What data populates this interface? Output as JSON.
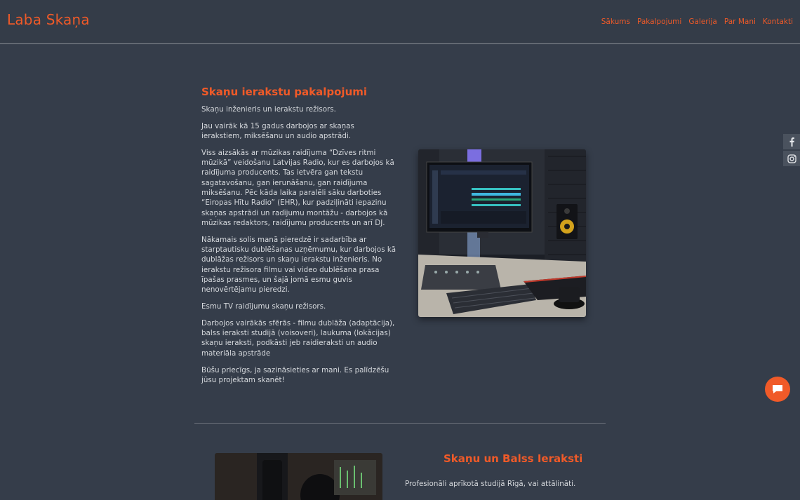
{
  "header": {
    "logo": "Laba Skaņa",
    "nav": [
      "Sākums",
      "Pakalpojumi",
      "Galerija",
      "Par Mani",
      "Kontakti"
    ]
  },
  "about": {
    "title": "Skaņu ierakstu pakalpojumi",
    "paragraphs": [
      "Skaņu inženieris un ierakstu režisors.",
      "Jau vairāk kā 15 gadus darbojos ar skaņas ierakstiem, miksēšanu un audio apstrādi.",
      "Viss aizsākās ar mūzikas raidījuma “Dzīves ritmi mūzikā” veidošanu Latvijas Radio, kur es darbojos kā raidījuma producents. Tas ietvēra gan tekstu sagatavošanu, gan ierunāšanu, gan raidījuma miksēšanu. Pēc kāda laika paralēli sāku darboties “Eiropas Hītu Radio” (EHR), kur padziļināti iepazinu skaņas apstrādi un radījumu montāžu - darbojos kā mūzikas redaktors, raidījumu producents un arī DJ.",
      "Nākamais solis manā pieredzē ir sadarbība ar starptautisku dublēšanas uzņēmumu, kur darbojos kā dublāžas režisors un skaņu ierakstu inženieris. No ierakstu režisora filmu vai video dublēšana prasa īpašas prasmes, un šajā jomā esmu guvis nenovērtējamu pieredzi.",
      "Esmu TV raidījumu skaņu režisors.",
      "Darbojos vairākās sfērās - filmu dublāža (adaptācija), balss ieraksti studijā (voisoveri), laukuma (lokācijas) skaņu ieraksti, podkāsti jeb raidieraksti un audio materiāla apstrāde",
      "Būšu priecīgs, ja sazināsieties ar mani. Es palīdzēšu jūsu projektam skanēt!"
    ]
  },
  "section2": {
    "title": "Skaņu un Balss Ieraksti",
    "text": "Profesionāli aprīkotā studijā Rīgā, vai attālināti."
  },
  "colors": {
    "accent": "#f05a28",
    "background": "#353d4a"
  },
  "icons": {
    "social": [
      "facebook-icon",
      "instagram-icon"
    ],
    "chat": "chat-icon"
  }
}
